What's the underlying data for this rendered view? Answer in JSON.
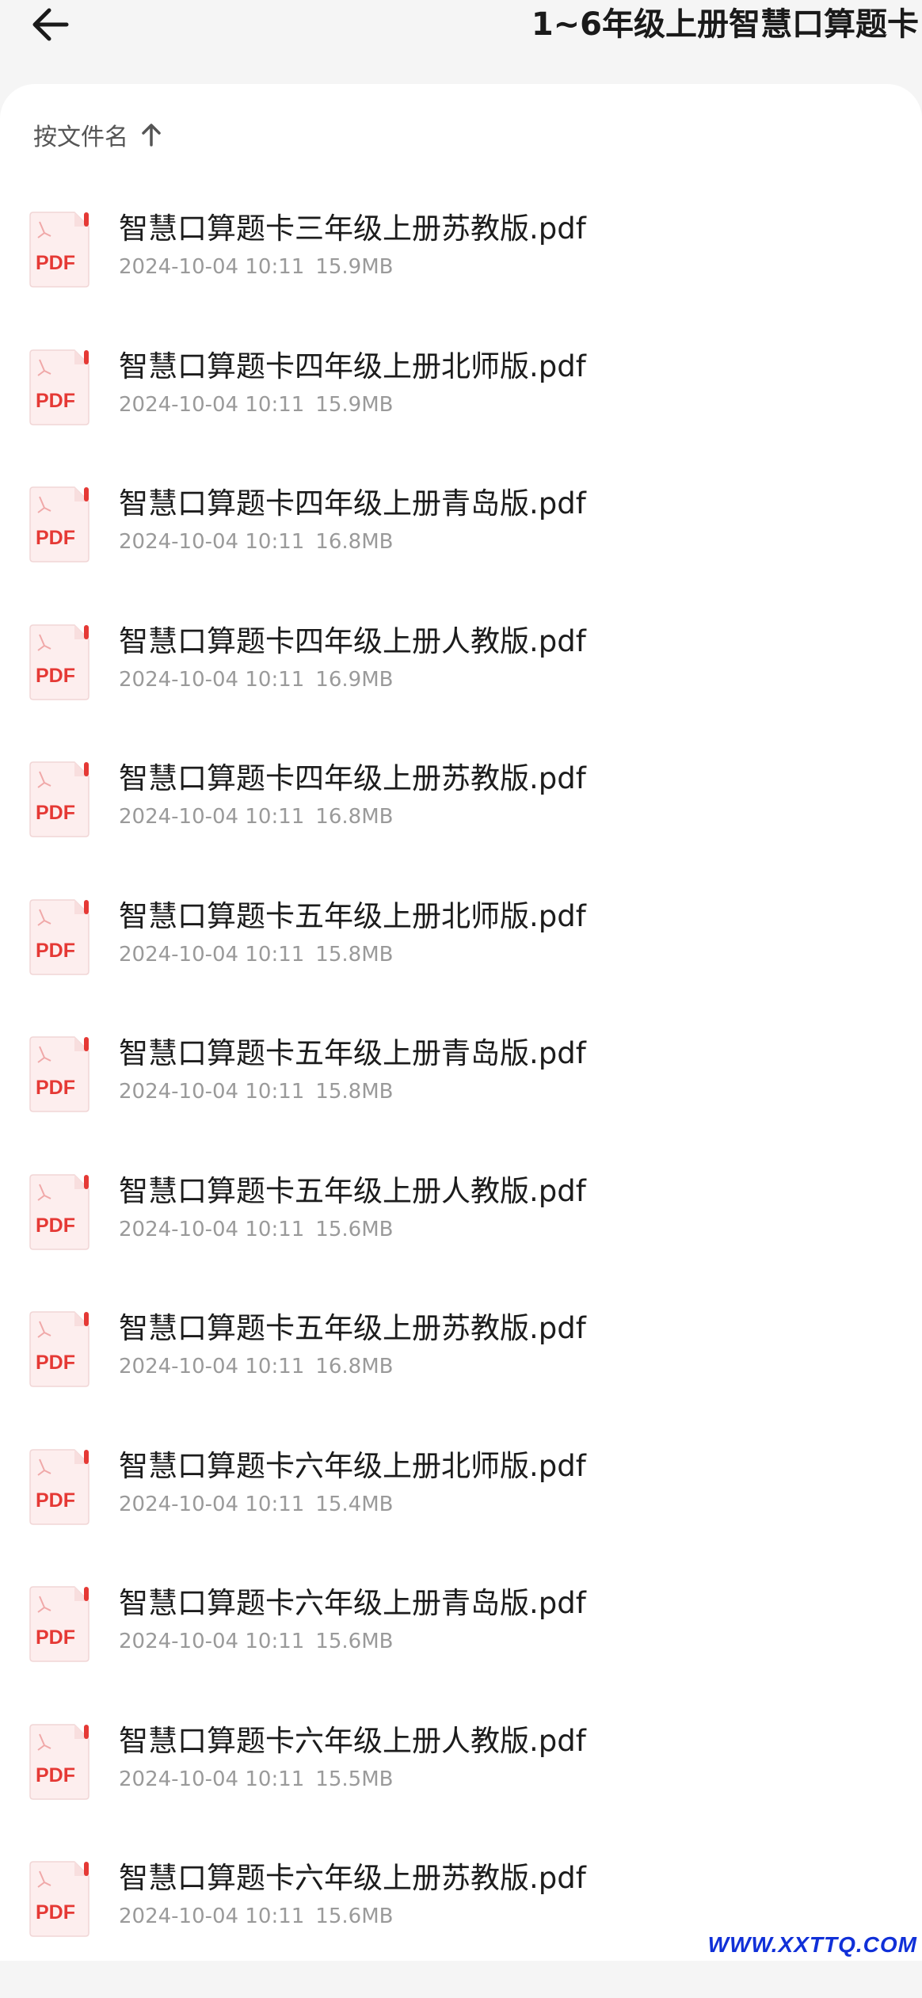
{
  "header": {
    "back_icon": "back-arrow-icon",
    "title": "1~6年级上册智慧口算题卡"
  },
  "sort": {
    "label": "按文件名",
    "icon": "arrow-up-icon"
  },
  "colors": {
    "pdf_red": "#e53935",
    "pdf_icon_bg": "#fdeeee"
  },
  "files": [
    {
      "icon": "PDF",
      "name": "智慧口算题卡三年级上册苏教版.pdf",
      "date": "2024-10-04 10:11",
      "size": "15.9MB"
    },
    {
      "icon": "PDF",
      "name": "智慧口算题卡四年级上册北师版.pdf",
      "date": "2024-10-04 10:11",
      "size": "15.9MB"
    },
    {
      "icon": "PDF",
      "name": "智慧口算题卡四年级上册青岛版.pdf",
      "date": "2024-10-04 10:11",
      "size": "16.8MB"
    },
    {
      "icon": "PDF",
      "name": "智慧口算题卡四年级上册人教版.pdf",
      "date": "2024-10-04 10:11",
      "size": "16.9MB"
    },
    {
      "icon": "PDF",
      "name": "智慧口算题卡四年级上册苏教版.pdf",
      "date": "2024-10-04 10:11",
      "size": "16.8MB"
    },
    {
      "icon": "PDF",
      "name": "智慧口算题卡五年级上册北师版.pdf",
      "date": "2024-10-04 10:11",
      "size": "15.8MB"
    },
    {
      "icon": "PDF",
      "name": "智慧口算题卡五年级上册青岛版.pdf",
      "date": "2024-10-04 10:11",
      "size": "15.8MB"
    },
    {
      "icon": "PDF",
      "name": "智慧口算题卡五年级上册人教版.pdf",
      "date": "2024-10-04 10:11",
      "size": "15.6MB"
    },
    {
      "icon": "PDF",
      "name": "智慧口算题卡五年级上册苏教版.pdf",
      "date": "2024-10-04 10:11",
      "size": "16.8MB"
    },
    {
      "icon": "PDF",
      "name": "智慧口算题卡六年级上册北师版.pdf",
      "date": "2024-10-04 10:11",
      "size": "15.4MB"
    },
    {
      "icon": "PDF",
      "name": "智慧口算题卡六年级上册青岛版.pdf",
      "date": "2024-10-04 10:11",
      "size": "15.6MB"
    },
    {
      "icon": "PDF",
      "name": "智慧口算题卡六年级上册人教版.pdf",
      "date": "2024-10-04 10:11",
      "size": "15.5MB"
    },
    {
      "icon": "PDF",
      "name": "智慧口算题卡六年级上册苏教版.pdf",
      "date": "2024-10-04 10:11",
      "size": "15.6MB"
    }
  ],
  "watermark": "WWW.XXTTQ.COM"
}
